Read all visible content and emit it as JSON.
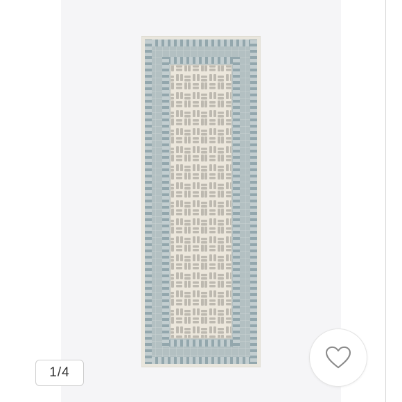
{
  "gallery": {
    "counter": {
      "current": "1",
      "separator": "/",
      "total": "4"
    },
    "image": {
      "icon": "rug-image"
    },
    "favorite": {
      "icon": "heart-icon"
    }
  },
  "colors": {
    "stage_background": "#f5f5f7",
    "rug_field": "#ece7dc",
    "rug_pattern": "#b9b6ad",
    "rug_border": "#aebcc0",
    "rug_border_mark": "#8fa3aa"
  }
}
